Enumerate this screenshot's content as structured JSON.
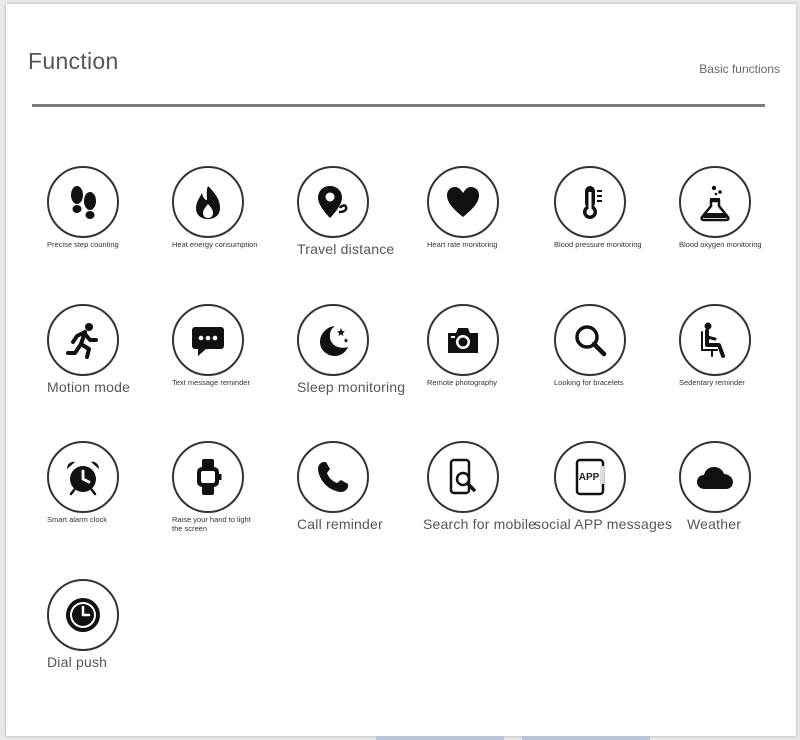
{
  "header": {
    "title": "Function",
    "subtitle": "Basic functions"
  },
  "functions": [
    {
      "label": "Precise step counting",
      "icon": "footprints-icon",
      "size": "small"
    },
    {
      "label": "Heat energy consumption",
      "icon": "flame-icon",
      "size": "small"
    },
    {
      "label": "Travel distance",
      "icon": "location-pin-icon",
      "size": "big"
    },
    {
      "label": "Heart rate monitoring",
      "icon": "heart-icon",
      "size": "small"
    },
    {
      "label": "Blood pressure monitoring",
      "icon": "thermometer-icon",
      "size": "small"
    },
    {
      "label": "Blood oxygen monitoring",
      "icon": "flask-icon",
      "size": "small"
    },
    {
      "label": "Motion mode",
      "icon": "running-person-icon",
      "size": "big"
    },
    {
      "label": "Text message reminder",
      "icon": "chat-bubble-icon",
      "size": "small"
    },
    {
      "label": "Sleep monitoring",
      "icon": "moon-stars-icon",
      "size": "big"
    },
    {
      "label": "Remote photography",
      "icon": "camera-icon",
      "size": "small"
    },
    {
      "label": "Looking for bracelets",
      "icon": "magnifier-icon",
      "size": "small"
    },
    {
      "label": "Sedentary reminder",
      "icon": "seated-person-icon",
      "size": "small"
    },
    {
      "label": "Smart alarm clock",
      "icon": "alarm-clock-icon",
      "size": "small"
    },
    {
      "label": "Raise your hand to light the screen",
      "icon": "smartwatch-icon",
      "size": "small"
    },
    {
      "label": "Call reminder",
      "icon": "phone-icon",
      "size": "big"
    },
    {
      "label": "Search for mobile",
      "icon": "phone-search-icon",
      "size": "big"
    },
    {
      "label": "social APP messages",
      "icon": "app-phone-icon",
      "icon_text": "APP",
      "size": "big"
    },
    {
      "label": "Weather",
      "icon": "cloud-icon",
      "size": "big"
    },
    {
      "label": "Dial push",
      "icon": "watch-face-icon",
      "size": "big"
    }
  ]
}
